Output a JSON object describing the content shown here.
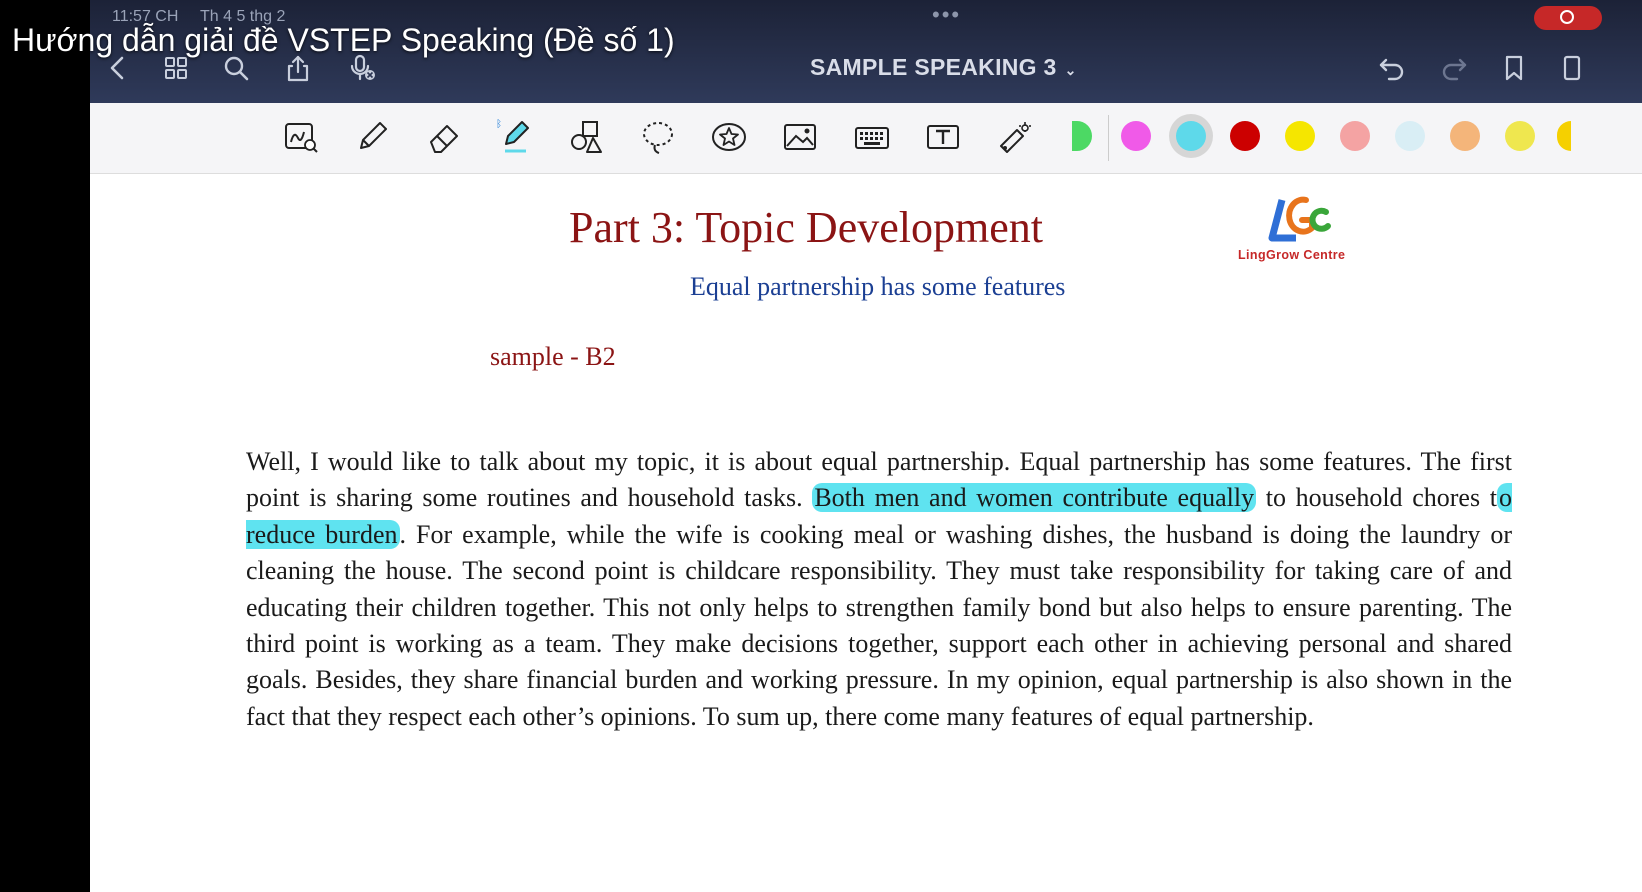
{
  "video": {
    "title": "Hướng dẫn giải đề VSTEP Speaking (Đề số 1)"
  },
  "status": {
    "time": "11:57 CH",
    "date": "Th 4 5 thg 2"
  },
  "topbar": {
    "document_title": "SAMPLE SPEAKING 3",
    "icons": [
      "back-icon",
      "grid-icon",
      "search-icon",
      "share-icon",
      "mic-off-icon",
      "undo-icon",
      "redo-icon",
      "bookmark-icon"
    ]
  },
  "toolbar": {
    "tools": [
      "handwriting-zoom",
      "pencil",
      "eraser",
      "highlighter",
      "shapes",
      "lasso",
      "sticker",
      "image",
      "keyboard",
      "text",
      "laser-pointer"
    ],
    "colors": [
      "#4cd964",
      "#f05ae8",
      "#5ed9ea",
      "#cc0000",
      "#f5e600",
      "#f4a3a3",
      "#d9eef5",
      "#f4b57a",
      "#efe74f"
    ],
    "selected_color": "#5ed9ea"
  },
  "document": {
    "heading": "Part 3: Topic Development",
    "subheading": "Equal partnership has some features",
    "level": "sample - B2",
    "logo_text": "LingGrow Centre",
    "paragraph": {
      "p1": "Well, I would like to talk about my topic, it is about equal partnership. Equal partnership has some features. The first point is sharing some routines and household tasks. ",
      "h1": "Both men and women contribute equally",
      "p2": " to household chores t",
      "h2": "o reduce burden",
      "p3": ". For example, while the wife is cooking meal or washing dishes, the husband is doing the laundry or cleaning the house. The second point is childcare responsibility. They must take responsibility for taking care of and educating their children together. This not only helps to strengthen family bond but also helps to ensure parenting. The third point is working as a team. They make decisions together, support each other in achieving personal and shared goals. Besides, they share financial burden and working pressure. In my opinion, equal partnership is also shown in the fact that they respect each other’s opinions. To sum up, there come many features of equal partnership."
    }
  }
}
